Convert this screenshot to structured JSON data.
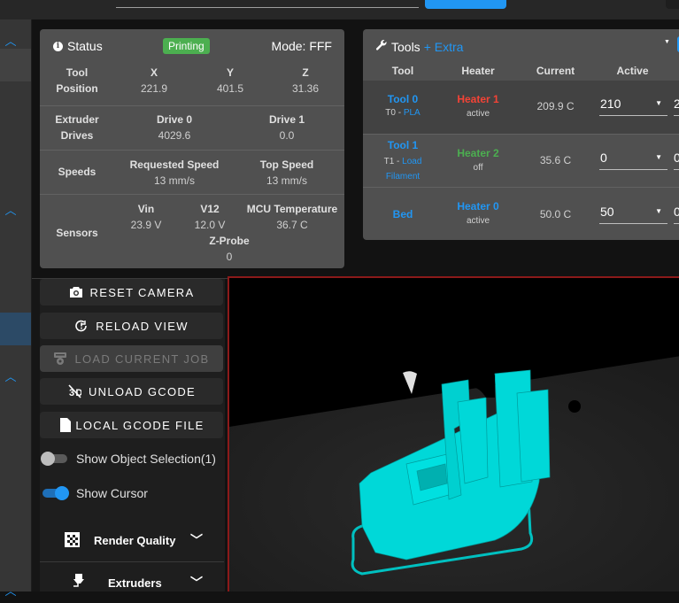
{
  "status": {
    "title": "Status",
    "badge": "Printing",
    "mode": "Mode: FFF",
    "tool_position": {
      "label_line1": "Tool",
      "label_line2": "Position",
      "axes": [
        {
          "name": "X",
          "value": "221.9"
        },
        {
          "name": "Y",
          "value": "401.5"
        },
        {
          "name": "Z",
          "value": "31.36"
        }
      ]
    },
    "extruder_drives": {
      "label_line1": "Extruder",
      "label_line2": "Drives",
      "drives": [
        {
          "name": "Drive 0",
          "value": "4029.6"
        },
        {
          "name": "Drive 1",
          "value": "0.0"
        }
      ]
    },
    "speeds": {
      "label": "Speeds",
      "items": [
        {
          "name": "Requested Speed",
          "value": "13 mm/s"
        },
        {
          "name": "Top Speed",
          "value": "13 mm/s"
        }
      ]
    },
    "sensors": {
      "label": "Sensors",
      "items": [
        {
          "name": "Vin",
          "value": "23.9 V"
        },
        {
          "name": "V12",
          "value": "12.0 V"
        },
        {
          "name": "MCU Temperature",
          "value": "36.7 C"
        },
        {
          "name": "Z-Probe",
          "value": "0"
        }
      ]
    }
  },
  "tools": {
    "title": "Tools",
    "extra_label": "+ Extra",
    "columns": [
      "Tool",
      "Heater",
      "Current",
      "Active"
    ],
    "rows": [
      {
        "tool": "Tool 0",
        "tool_sub_prefix": "T0 -",
        "tool_sub_link": "PLA",
        "heater": "Heater 1",
        "heater_state": "active",
        "current": "209.9 C",
        "active": "210",
        "standby_partial": "2"
      },
      {
        "tool": "Tool 1",
        "tool_sub_prefix": "T1 -",
        "tool_sub_link": "Load Filament",
        "heater": "Heater 2",
        "heater_state": "off",
        "current": "35.6 C",
        "active": "0",
        "standby_partial": "0"
      },
      {
        "tool": "Bed",
        "heater": "Heater 0",
        "heater_state": "active",
        "current": "50.0 C",
        "active": "50",
        "standby_partial": "0"
      }
    ]
  },
  "viewer_controls": {
    "buttons": [
      {
        "label": "RESET CAMERA",
        "icon": "camera-icon",
        "disabled": false
      },
      {
        "label": "RELOAD VIEW",
        "icon": "reload-icon",
        "disabled": false
      },
      {
        "label": "LOAD CURRENT JOB",
        "icon": "printer-icon",
        "disabled": true
      },
      {
        "label": "UNLOAD GCODE",
        "icon": "unload-icon",
        "disabled": false
      },
      {
        "label": "LOCAL GCODE FILE",
        "icon": "file-icon",
        "disabled": false
      }
    ],
    "toggles": [
      {
        "label": "Show Object Selection(1)",
        "on": false
      },
      {
        "label": "Show Cursor",
        "on": true
      }
    ],
    "panels": [
      {
        "label": "Render Quality",
        "icon": "checkerboard-icon"
      },
      {
        "label": "Extruders",
        "icon": "extruder-icon"
      }
    ]
  },
  "colors": {
    "accent": "#2196f3",
    "printing_badge": "#4caf50",
    "heater_active": "#f44336",
    "heater_off": "#4caf50",
    "model": "#00d8d8",
    "viewer_border": "#8b1a1a"
  }
}
